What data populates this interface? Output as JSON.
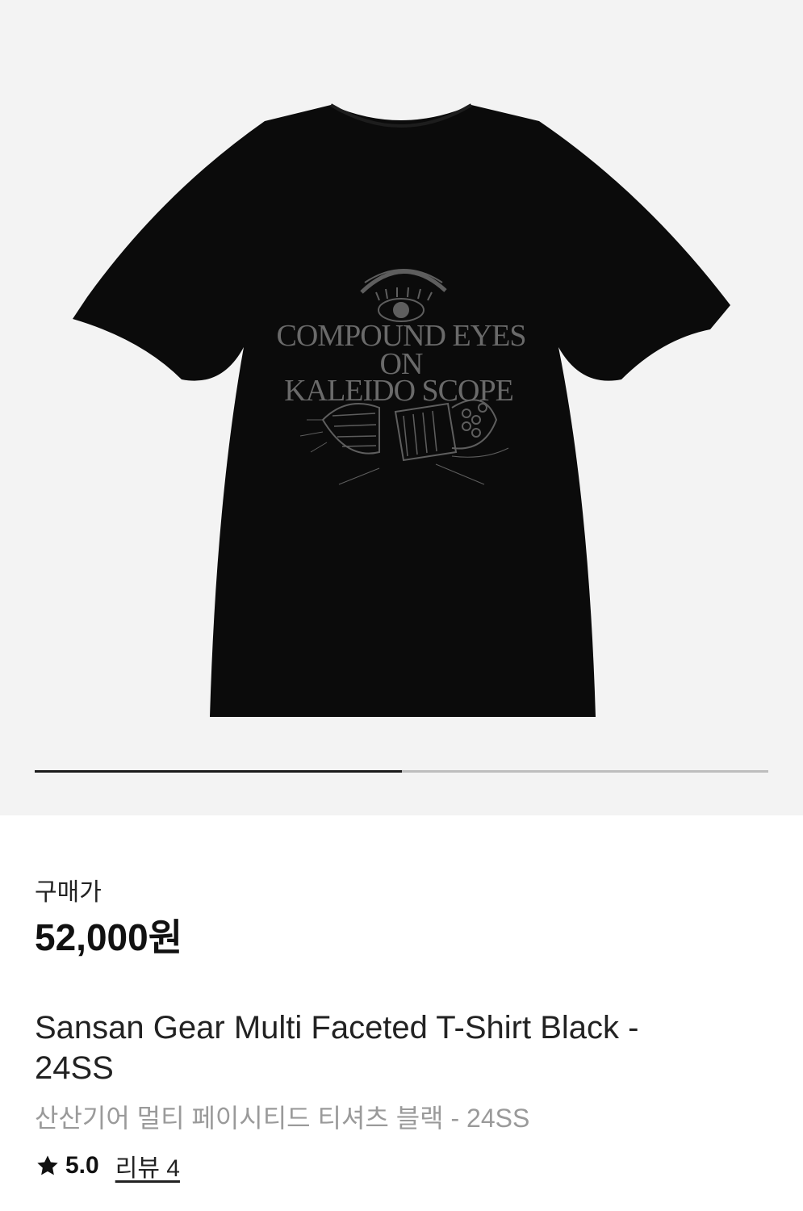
{
  "product_image": {
    "print_text": [
      "COMPOUND EYES",
      "ON",
      "KALEIDO SCOPE"
    ],
    "shirt_color": "#0b0b0b",
    "print_color": "#5e5e5e"
  },
  "gallery": {
    "progress_fraction": 0.5,
    "track_color": "#bdbdbd",
    "fill_color": "#1a1a1a"
  },
  "price": {
    "label": "구매가",
    "value": "52,000원"
  },
  "product": {
    "title": "Sansan Gear Multi Faceted T-Shirt Black - 24SS",
    "subtitle": "산산기어 멀티 페이시티드 티셔츠 블랙 - 24SS"
  },
  "rating": {
    "icon": "star-icon",
    "value": "5.0",
    "review_link": "리뷰 4"
  }
}
